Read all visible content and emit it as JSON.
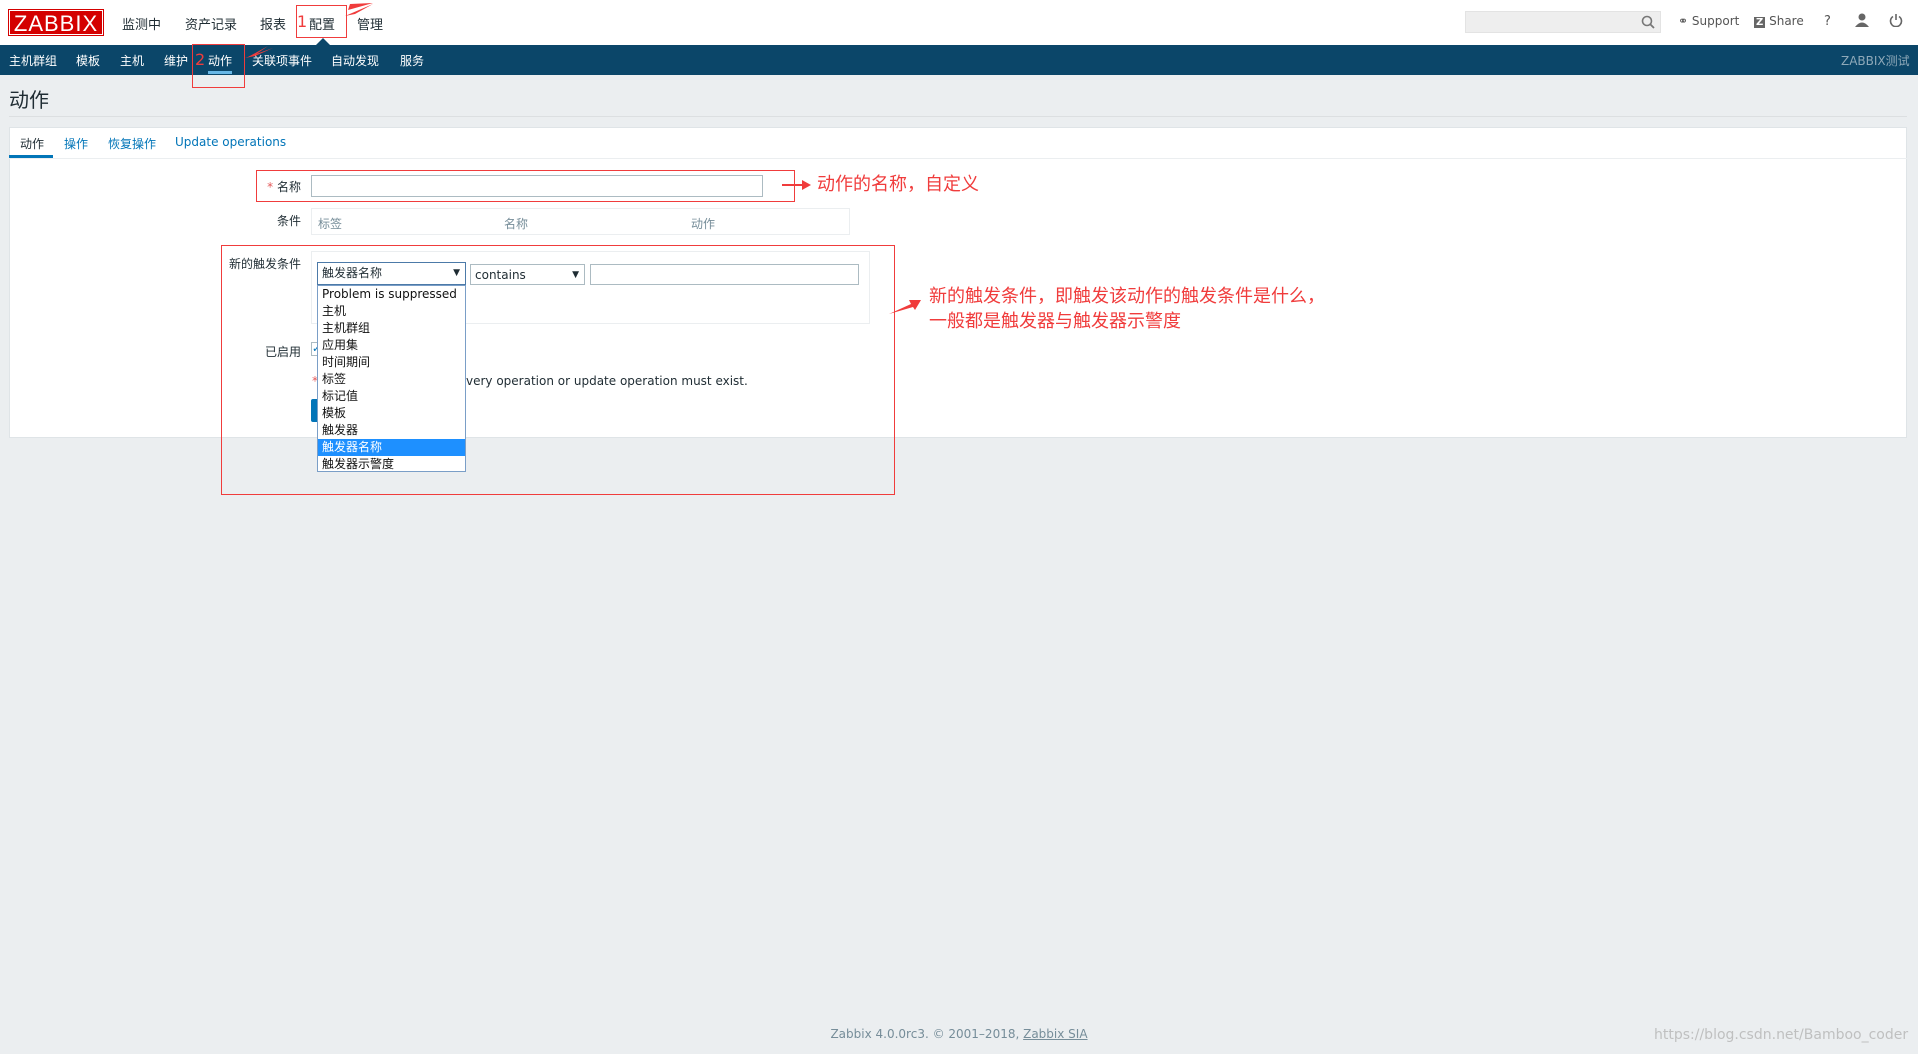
{
  "logo": "ZABBIX",
  "top_menu": [
    "监测中",
    "资产记录",
    "报表",
    "配置",
    "管理"
  ],
  "sub_menu": [
    "主机群组",
    "模板",
    "主机",
    "维护",
    "动作",
    "关联项事件",
    "自动发现",
    "服务"
  ],
  "header_right": {
    "support": "Support",
    "share": "Share",
    "help": "?",
    "server_name": "ZABBIX测试"
  },
  "page_title": "动作",
  "tabs": [
    "动作",
    "操作",
    "恢复操作",
    "Update operations"
  ],
  "form": {
    "name_label": "名称",
    "name_value": "",
    "conditions_label": "条件",
    "conditions_headers": [
      "标签",
      "名称",
      "动作"
    ],
    "new_condition_label": "新的触发条件",
    "condition_type_selected": "触发器名称",
    "operator_selected": "contains",
    "condition_value": "",
    "condition_type_options": [
      "Problem is suppressed",
      "主机",
      "主机群组",
      "应用集",
      "时间期间",
      "标签",
      "标记值",
      "模板",
      "触发器",
      "触发器名称",
      "触发器示警度"
    ],
    "enabled_label": "已启用",
    "enabled": true,
    "note_fragment": "very operation or update operation must exist."
  },
  "annotations": {
    "step1": "1",
    "step2": "2",
    "name_note": "动作的名称，自定义",
    "condition_note_1": "新的触发条件，即触发该动作的触发条件是什么，",
    "condition_note_2": "一般都是触发器与触发器示警度"
  },
  "footer": {
    "text": "Zabbix 4.0.0rc3. © 2001–2018, ",
    "link": "Zabbix SIA"
  },
  "watermark": "https://blog.csdn.net/Bamboo_coder",
  "colors": {
    "brand": "#d40000",
    "nav": "#0b4669",
    "link": "#0275b8",
    "annotation": "#f03c3c",
    "selected": "#1e90ff"
  }
}
